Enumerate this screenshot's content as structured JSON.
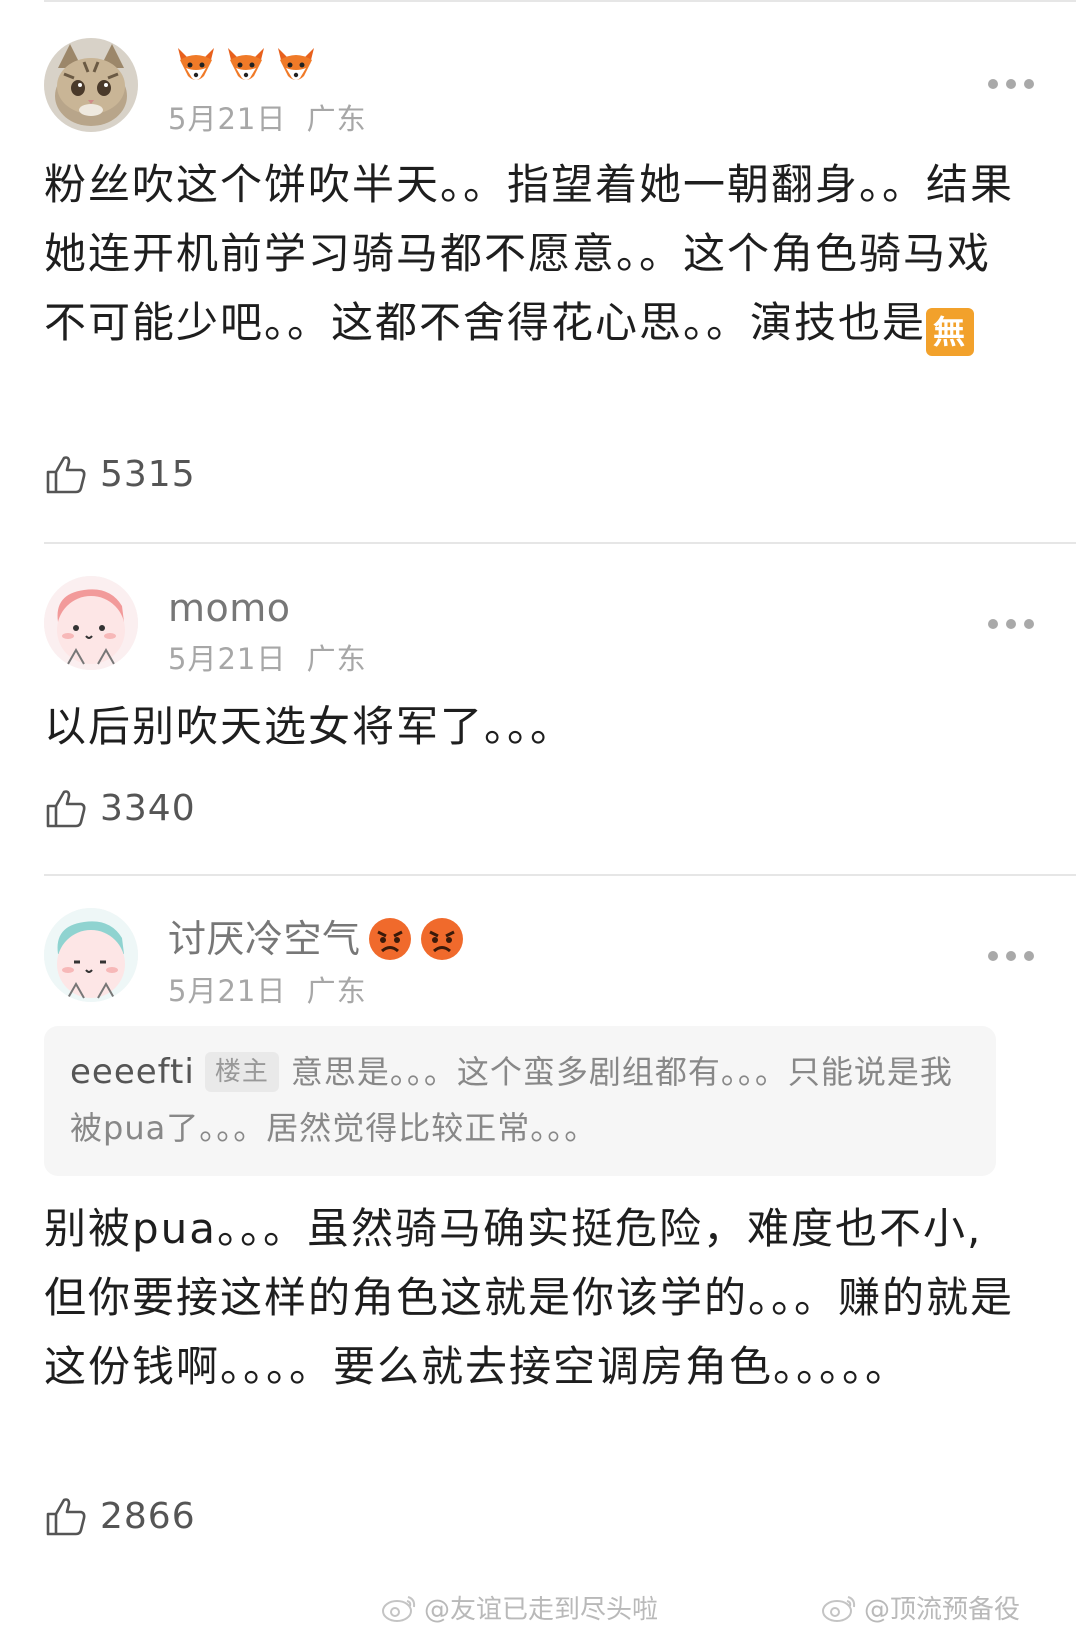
{
  "comments": [
    {
      "username": "",
      "name_emojis": [
        "fox-emoji",
        "fox-emoji",
        "fox-emoji"
      ],
      "date": "5月21日",
      "location": "广东",
      "text": "粉丝吹这个饼吹半天。。指望着她一朝翻身。。结果她连开机前学习骑马都不愿意。。这个角色骑马戏不可能少吧。。这都不舍得花心思。。演技也是",
      "text_emoji": "無",
      "likes": "5315"
    },
    {
      "username": "momo",
      "date": "5月21日",
      "location": "广东",
      "text": "以后别吹天选女将军了。。。",
      "likes": "3340"
    },
    {
      "username": "讨厌冷空气",
      "name_emojis": [
        "angry-emoji",
        "angry-emoji"
      ],
      "date": "5月21日",
      "location": "广东",
      "quote": {
        "user": "eeeefti",
        "badge": "楼主",
        "text": "意思是。。。这个蛮多剧组都有。。。只能说是我被pua了。。。居然觉得比较正常。。。"
      },
      "text": "别被pua。。。虽然骑马确实挺危险，难度也不小,但你要接这样的角色这就是你该学的。。。赚的就是这份钱啊。。。。要么就去接空调房角色。。。。。",
      "likes": "2866"
    }
  ],
  "watermarks": [
    "@友谊已走到尽头啦",
    "@顶流预备役"
  ],
  "colors": {
    "accent_emoji": "#f2a12b",
    "meta_gray": "#a7a7a7",
    "text": "#1e1e1e"
  }
}
